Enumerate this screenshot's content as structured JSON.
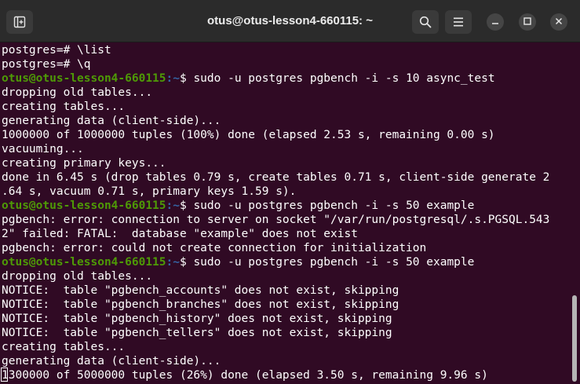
{
  "window": {
    "title": "otus@otus-lesson4-660115: ~"
  },
  "icons": {
    "new_tab": "new-tab-icon",
    "search": "search-icon",
    "menu": "hamburger-menu-icon",
    "minimize": "minimize-icon",
    "maximize": "maximize-icon",
    "close": "close-icon"
  },
  "colors": {
    "terminal_bg": "#300a24",
    "prompt_user": "#4e9a06",
    "prompt_path": "#3465a4",
    "text": "#ffffff",
    "titlebar": "#2b2b2b"
  },
  "terminal": {
    "lines": [
      {
        "text": "postgres=# \\list"
      },
      {
        "text": "postgres=# \\q"
      },
      {
        "user": "otus@otus-lesson4-660115",
        "path": ":~",
        "text": "$ sudo -u postgres pgbench -i -s 10 async_test"
      },
      {
        "text": "dropping old tables..."
      },
      {
        "text": "creating tables..."
      },
      {
        "text": "generating data (client-side)..."
      },
      {
        "text": "1000000 of 1000000 tuples (100%) done (elapsed 2.53 s, remaining 0.00 s)"
      },
      {
        "text": "vacuuming..."
      },
      {
        "text": "creating primary keys..."
      },
      {
        "text": "done in 6.45 s (drop tables 0.79 s, create tables 0.71 s, client-side generate 2"
      },
      {
        "text": ".64 s, vacuum 0.71 s, primary keys 1.59 s)."
      },
      {
        "user": "otus@otus-lesson4-660115",
        "path": ":~",
        "text": "$ sudo -u postgres pgbench -i -s 50 example"
      },
      {
        "text": "pgbench: error: connection to server on socket \"/var/run/postgresql/.s.PGSQL.543"
      },
      {
        "text": "2\" failed: FATAL:  database \"example\" does not exist"
      },
      {
        "text": "pgbench: error: could not create connection for initialization"
      },
      {
        "user": "otus@otus-lesson4-660115",
        "path": ":~",
        "text": "$ sudo -u postgres pgbench -i -s 50 example"
      },
      {
        "text": "dropping old tables..."
      },
      {
        "text": "NOTICE:  table \"pgbench_accounts\" does not exist, skipping"
      },
      {
        "text": "NOTICE:  table \"pgbench_branches\" does not exist, skipping"
      },
      {
        "text": "NOTICE:  table \"pgbench_history\" does not exist, skipping"
      },
      {
        "text": "NOTICE:  table \"pgbench_tellers\" does not exist, skipping"
      },
      {
        "text": "creating tables..."
      },
      {
        "text": "generating data (client-side)..."
      },
      {
        "text": "1300000 of 5000000 tuples (26%) done (elapsed 3.50 s, remaining 9.96 s)"
      }
    ]
  }
}
